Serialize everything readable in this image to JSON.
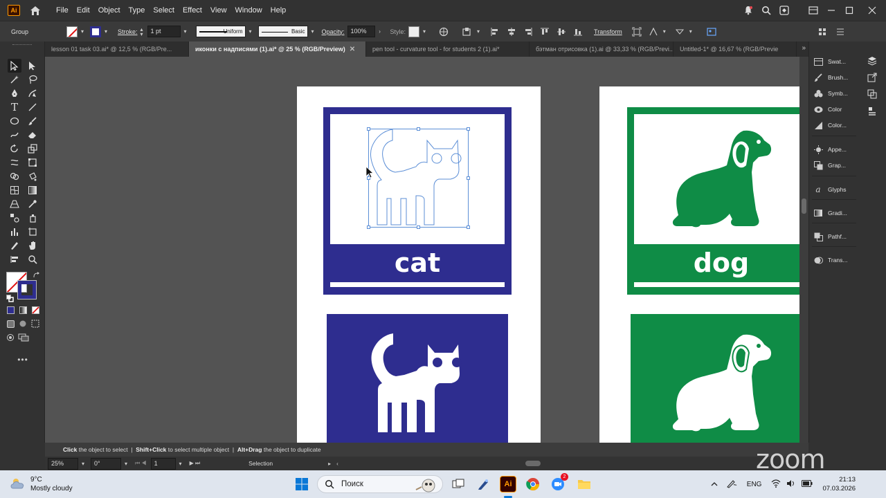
{
  "menubar": {
    "logo": "Ai",
    "items": [
      "File",
      "Edit",
      "Object",
      "Type",
      "Select",
      "Effect",
      "View",
      "Window",
      "Help"
    ]
  },
  "control": {
    "selection_type": "Group",
    "stroke_label": "Stroke:",
    "stroke_weight": "1 pt",
    "profile": "Uniform",
    "brush": "Basic",
    "opacity_label": "Opacity:",
    "opacity_value": "100%",
    "style_label": "Style:",
    "transform_label": "Transform"
  },
  "tabs": [
    {
      "label": "lesson 01 task 03.ai* @ 12,5 % (RGB/Pre...",
      "active": false
    },
    {
      "label": "иконки с надписями (1).ai* @ 25 % (RGB/Preview)",
      "active": true
    },
    {
      "label": "pen tool - curvature tool - for students 2 (1).ai*",
      "active": false
    },
    {
      "label": "бэтман отрисовка (1).ai @ 33,33 % (RGB/Previ...",
      "active": false
    },
    {
      "label": "Untitled-1* @ 16,67 % (RGB/Previe",
      "active": false
    }
  ],
  "artwork": {
    "cat_label": "cat",
    "dog_label": "dog",
    "colors": {
      "cat": "#2e2d8f",
      "dog": "#0f8c46",
      "selection": "#5b8ed6"
    }
  },
  "panels": [
    {
      "label": "Swat...",
      "icon": "swatches-icon"
    },
    {
      "label": "Brush...",
      "icon": "brushes-icon"
    },
    {
      "label": "Symb...",
      "icon": "symbols-icon"
    },
    {
      "label": "Color",
      "icon": "color-icon"
    },
    {
      "label": "Color...",
      "icon": "color-guide-icon"
    },
    {
      "label": "Appe...",
      "icon": "appearance-icon"
    },
    {
      "label": "Grap...",
      "icon": "graphic-styles-icon"
    },
    {
      "label": "Glyphs",
      "icon": "glyphs-icon"
    },
    {
      "label": "Gradi...",
      "icon": "gradient-icon"
    },
    {
      "label": "Pathf...",
      "icon": "pathfinder-icon"
    },
    {
      "label": "Trans...",
      "icon": "transparency-icon"
    }
  ],
  "status": {
    "hint_click": "Click",
    "hint_click_text": "the object to select",
    "hint_shift": "Shift+Click",
    "hint_shift_text": "to select multiple object",
    "hint_alt": "Alt+Drag",
    "hint_alt_text": "the object to duplicate",
    "zoom": "25%",
    "rotation": "0°",
    "artboard": "1",
    "tool": "Selection"
  },
  "watermark": "zoom",
  "taskbar": {
    "temperature": "9°C",
    "weather": "Mostly cloudy",
    "search_placeholder": "Поиск",
    "language": "ENG",
    "time": "21:13",
    "date": "07.03.2026",
    "zoom_badge": "2"
  }
}
